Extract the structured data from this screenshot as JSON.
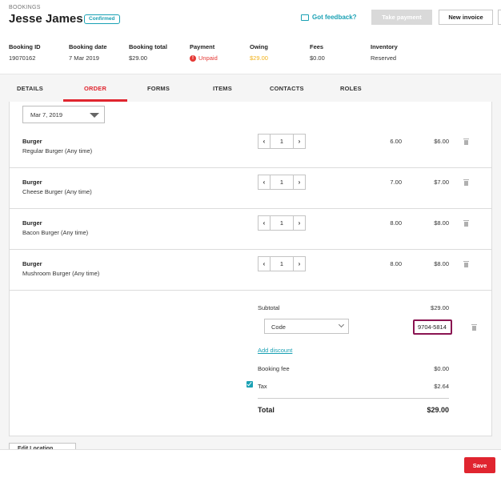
{
  "header": {
    "breadcrumb": "BOOKINGS",
    "title": "Jesse James",
    "status_badge": "Confirmed",
    "feedback_link": "Got feedback?",
    "take_payment_label": "Take payment",
    "new_invoice_label": "New invoice"
  },
  "summary": {
    "booking_id": {
      "label": "Booking ID",
      "value": "19070162"
    },
    "booking_date": {
      "label": "Booking date",
      "value": "7 Mar 2019"
    },
    "booking_total": {
      "label": "Booking total",
      "value": "$29.00"
    },
    "payment": {
      "label": "Payment",
      "value": "Unpaid"
    },
    "owing": {
      "label": "Owing",
      "value": "$29.00"
    },
    "fees": {
      "label": "Fees",
      "value": "$0.00"
    },
    "inventory": {
      "label": "Inventory",
      "value": "Reserved"
    }
  },
  "tabs": [
    "DETAILS",
    "ORDER",
    "FORMS",
    "ITEMS",
    "CONTACTS",
    "ROLES"
  ],
  "active_tab": "ORDER",
  "order": {
    "date": "Mar 7, 2019",
    "items": [
      {
        "name": "Burger",
        "desc": "Regular Burger (Any time)",
        "qty": "1",
        "unit": "6.00",
        "total": "$6.00"
      },
      {
        "name": "Burger",
        "desc": "Cheese Burger (Any time)",
        "qty": "1",
        "unit": "7.00",
        "total": "$7.00"
      },
      {
        "name": "Burger",
        "desc": "Bacon Burger (Any time)",
        "qty": "1",
        "unit": "8.00",
        "total": "$8.00"
      },
      {
        "name": "Burger",
        "desc": "Mushroom Burger (Any time)",
        "qty": "1",
        "unit": "8.00",
        "total": "$8.00"
      }
    ],
    "subtotal_label": "Subtotal",
    "subtotal": "$29.00",
    "code_select": "Code",
    "code_value": "9704-5814",
    "add_discount": "Add discount",
    "booking_fee_label": "Booking fee",
    "booking_fee": "$0.00",
    "tax_label": "Tax",
    "tax": "$2.64",
    "total_label": "Total",
    "total": "$29.00"
  },
  "edit_location_label": "Edit Location",
  "save_label": "Save",
  "colors": {
    "accent": "#e0252f",
    "teal": "#1aa1b4",
    "amber": "#f2b21b"
  }
}
